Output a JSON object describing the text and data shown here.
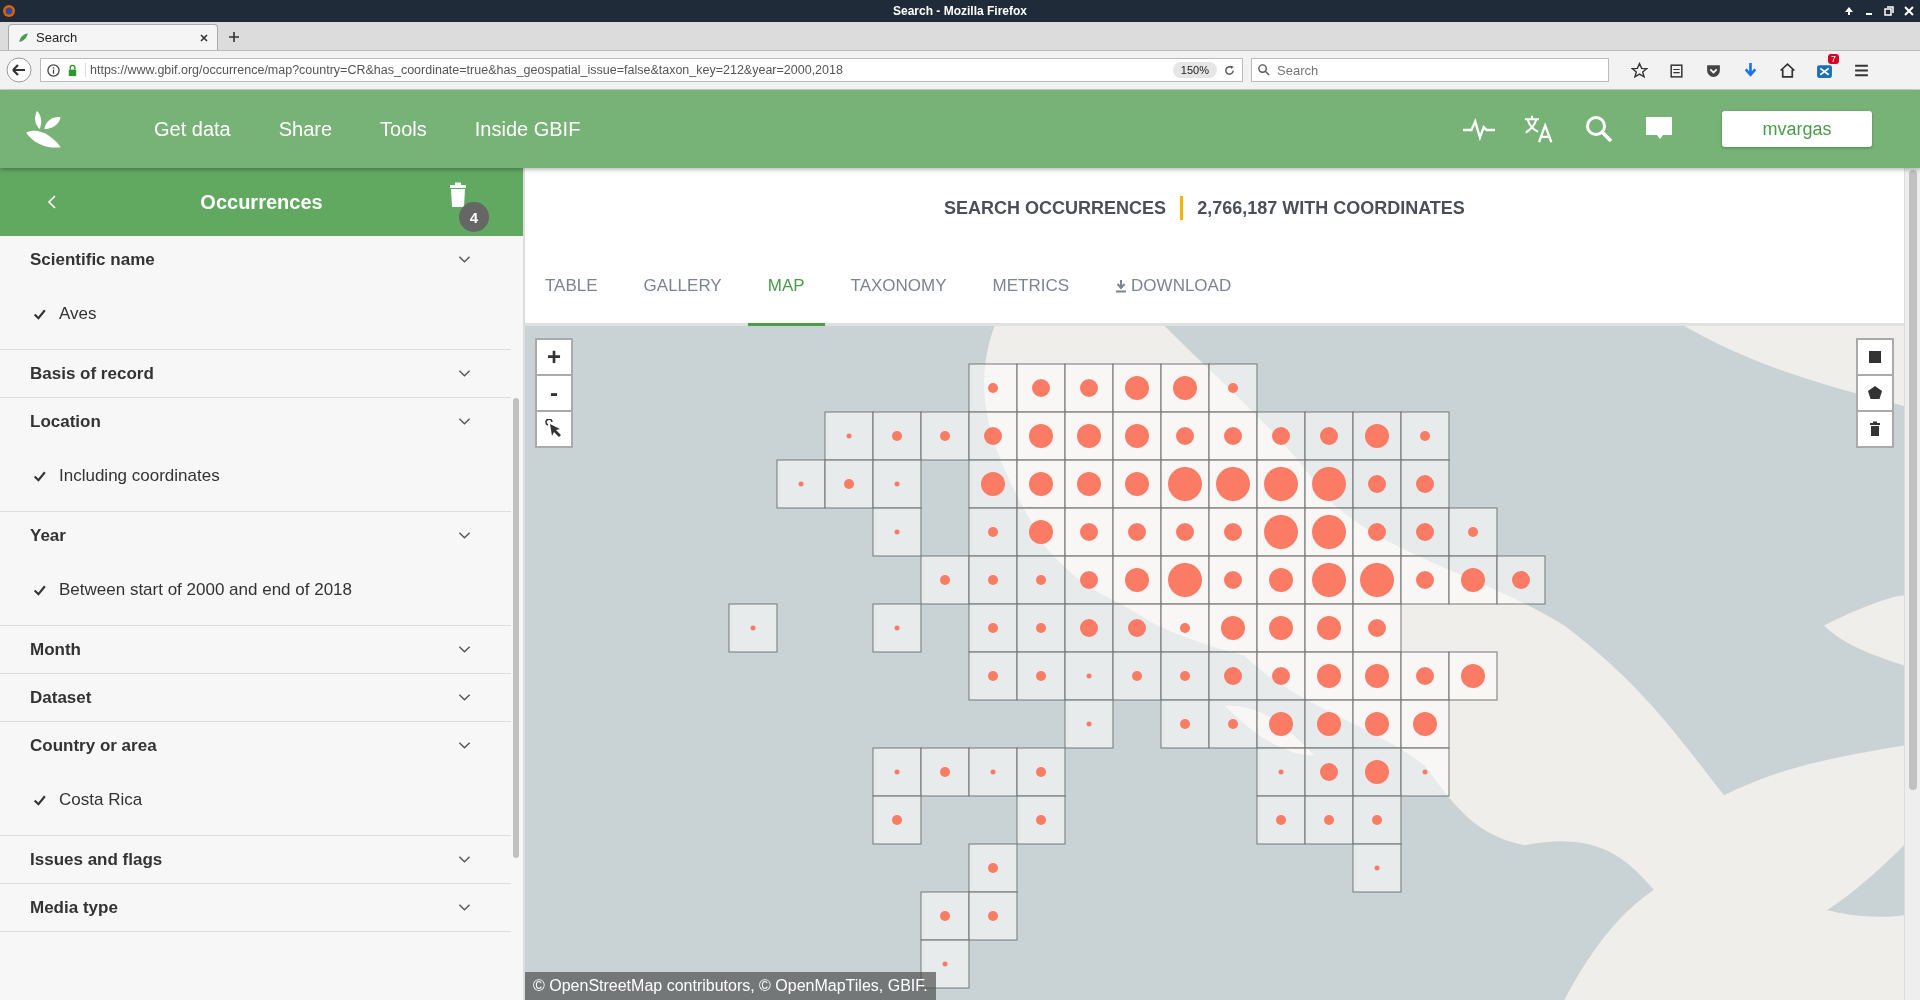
{
  "browser": {
    "window_title": "Search - Mozilla Firefox",
    "tabs": [
      {
        "title": "Search",
        "selected": true
      }
    ],
    "url": "https://www.gbif.org/occurrence/map?country=CR&has_coordinate=true&has_geospatial_issue=false&taxon_key=212&year=2000,2018",
    "zoom": "150%",
    "search": {
      "placeholder": "Search"
    },
    "extension_badge": "7"
  },
  "site_header": {
    "nav": [
      "Get data",
      "Share",
      "Tools",
      "Inside GBIF"
    ],
    "user_button": "mvargas"
  },
  "sidebar": {
    "title": "Occurrences",
    "filter_count": "4",
    "sections": [
      {
        "title": "Scientific name",
        "values": [
          {
            "label": "Aves",
            "checked": true
          }
        ]
      },
      {
        "title": "Basis of record"
      },
      {
        "title": "Location",
        "values": [
          {
            "label": "Including coordinates",
            "checked": true
          }
        ]
      },
      {
        "title": "Year",
        "values": [
          {
            "label": "Between start of 2000 and end of 2018",
            "checked": true
          }
        ]
      },
      {
        "title": "Month"
      },
      {
        "title": "Dataset"
      },
      {
        "title": "Country or area",
        "values": [
          {
            "label": "Costa Rica",
            "checked": true
          }
        ]
      },
      {
        "title": "Issues and flags"
      },
      {
        "title": "Media type"
      }
    ]
  },
  "content": {
    "heading": "SEARCH OCCURRENCES",
    "count": "2,766,187 WITH COORDINATES",
    "tabs": [
      {
        "label": "TABLE",
        "selected": false,
        "kind": "text"
      },
      {
        "label": "GALLERY",
        "selected": false,
        "kind": "text"
      },
      {
        "label": "MAP",
        "selected": true,
        "kind": "text"
      },
      {
        "label": "TAXONOMY",
        "selected": false,
        "kind": "text"
      },
      {
        "label": "METRICS",
        "selected": false,
        "kind": "text"
      },
      {
        "label": "DOWNLOAD",
        "selected": false,
        "kind": "download"
      }
    ],
    "map": {
      "zoom_in": "+",
      "zoom_out": "-",
      "attribution": "© OpenStreetMap contributors, © OpenMapTiles, GBIF."
    }
  }
}
